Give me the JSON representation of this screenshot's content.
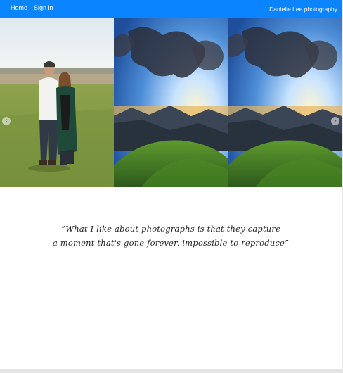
{
  "nav": {
    "home": "Home",
    "sign_in": "Sign in",
    "brand": "Danielle Lee photography"
  },
  "carousel": {
    "slides": [
      {
        "description_icon": "couple-photo"
      },
      {
        "description_icon": "landscape-photo"
      },
      {
        "description_icon": "landscape-photo"
      }
    ],
    "prev_arrow": "‹",
    "next_arrow": "›"
  },
  "quote": {
    "line1": "“What I like about photographs is that they capture",
    "line2": "a moment that's gone forever, impossible to reproduce”"
  },
  "colors": {
    "navbar": "#0a84ff",
    "background": "#ffffff"
  }
}
